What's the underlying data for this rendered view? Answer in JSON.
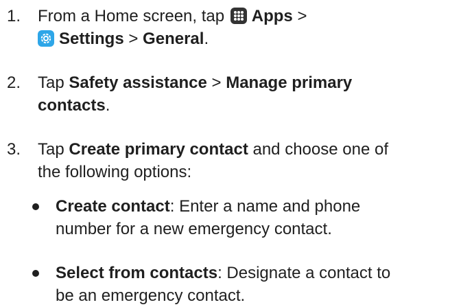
{
  "steps": [
    {
      "number": "1.",
      "line1_prefix": "From a Home screen, tap",
      "apps_icon": "apps-grid-icon",
      "apps_label": "Apps",
      "sep1": ">",
      "settings_icon": "settings-gear-icon",
      "settings_label": "Settings",
      "sep2": ">",
      "general_label": "General",
      "end": "."
    },
    {
      "number": "2.",
      "prefix": "Tap",
      "b1": "Safety assistance",
      "sep": ">",
      "b2_line1": "Manage primary",
      "b2_line2": "contacts",
      "end": "."
    },
    {
      "number": "3.",
      "prefix": "Tap",
      "b1": "Create primary contact",
      "rest_line1": "and choose one of",
      "line2": "the following options:"
    }
  ],
  "options": [
    {
      "label": "Create contact",
      "line1_rest": ": Enter a name and phone",
      "line2": "number for a new emergency contact."
    },
    {
      "label": "Select from contacts",
      "line1_rest": ": Designate a contact to",
      "line2": "be an emergency contact."
    }
  ],
  "colors": {
    "text": "#1f1f1f",
    "apps_icon_bg": "#333333",
    "settings_icon_bg": "#2ea6e8"
  }
}
